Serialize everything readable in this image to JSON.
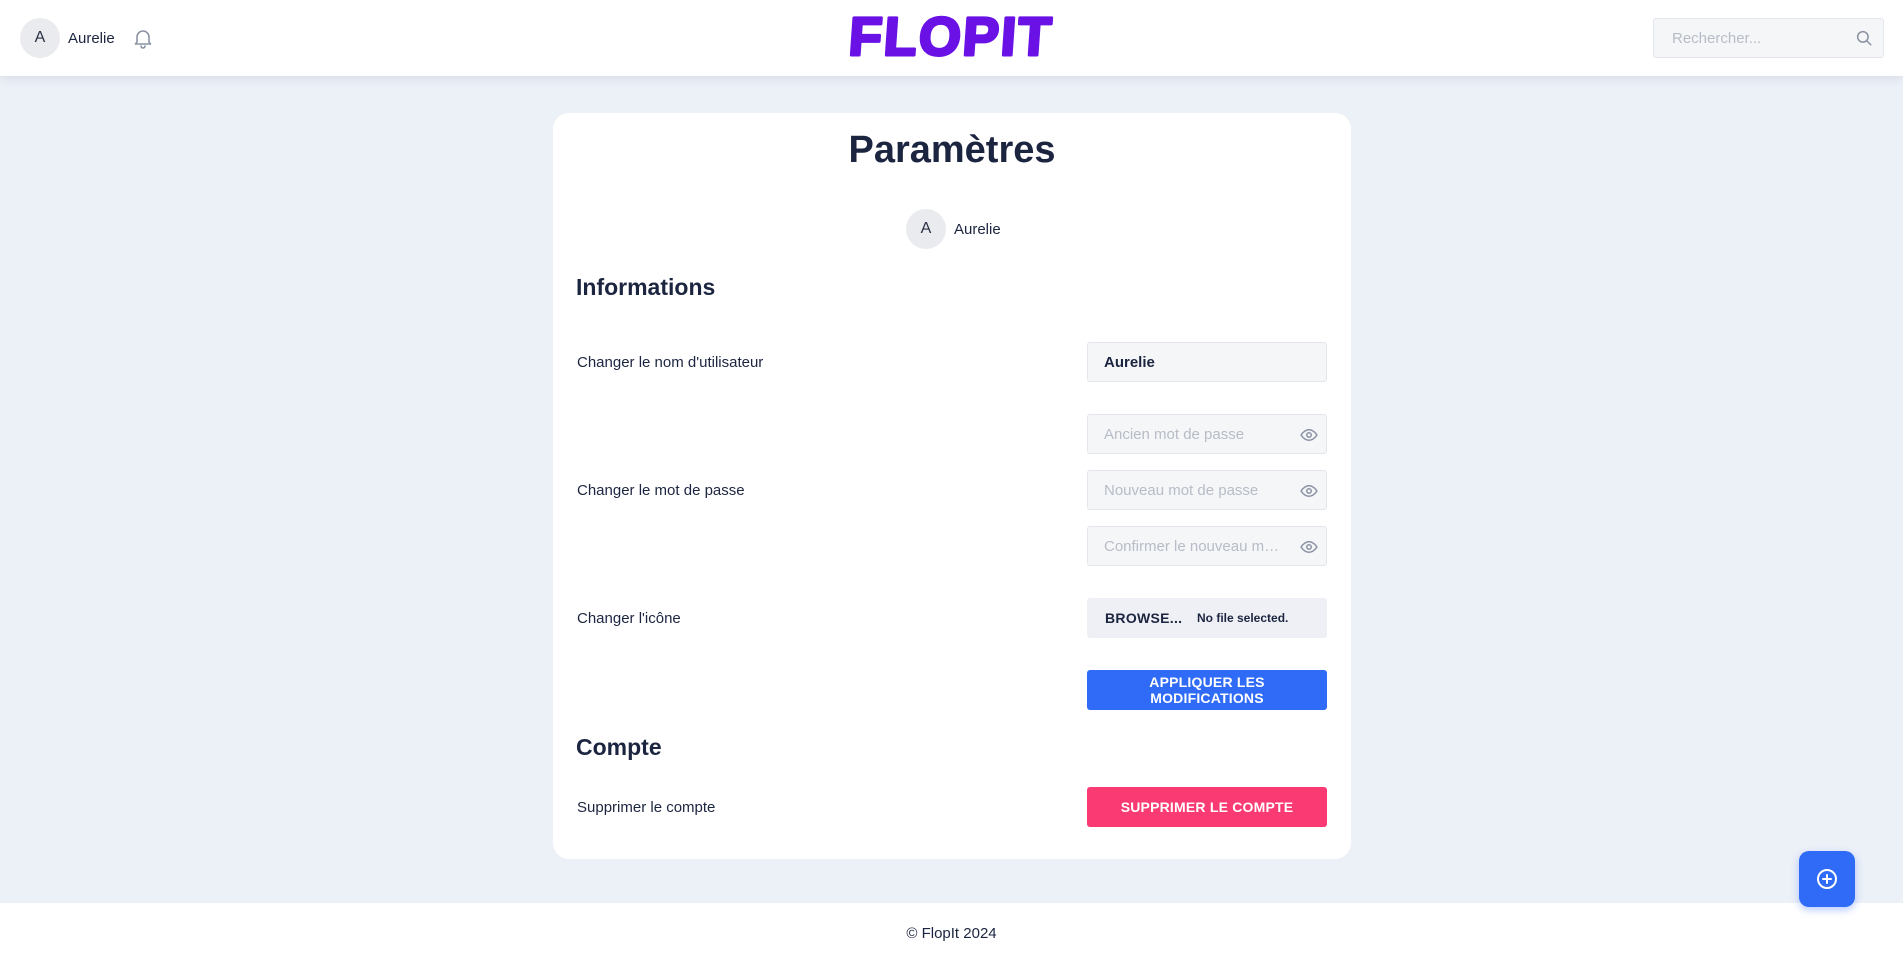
{
  "header": {
    "user": {
      "avatar_letter": "A",
      "name": "Aurelie"
    },
    "logo_text": "FLOPIT",
    "search": {
      "placeholder": "Rechercher...",
      "value": ""
    }
  },
  "settings": {
    "title": "Paramètres",
    "user": {
      "avatar_letter": "A",
      "name": "Aurelie"
    },
    "informations": {
      "title": "Informations",
      "username": {
        "label": "Changer le nom d'utilisateur",
        "value": "Aurelie"
      },
      "password": {
        "label": "Changer le mot de passe",
        "old_placeholder": "Ancien mot de passe",
        "new_placeholder": "Nouveau mot de passe",
        "confirm_placeholder": "Confirmer le nouveau mot de passe"
      },
      "icon": {
        "label": "Changer l'icône",
        "browse_label": "BROWSE...",
        "file_status": "No file selected."
      },
      "apply_label": "APPLIQUER LES MODIFICATIONS"
    },
    "account": {
      "title": "Compte",
      "delete": {
        "label": "Supprimer le compte",
        "button_label": "SUPPRIMER LE COMPTE"
      }
    }
  },
  "footer": {
    "text": "© FlopIt 2024"
  },
  "fab": {
    "icon": "plus-circle-icon"
  },
  "colors": {
    "background": "#ecf0f7",
    "brand_purple": "#6a12e6",
    "primary_blue": "#2f6bf6",
    "danger_pink": "#fa3a72",
    "text_dark": "#1c2540"
  }
}
